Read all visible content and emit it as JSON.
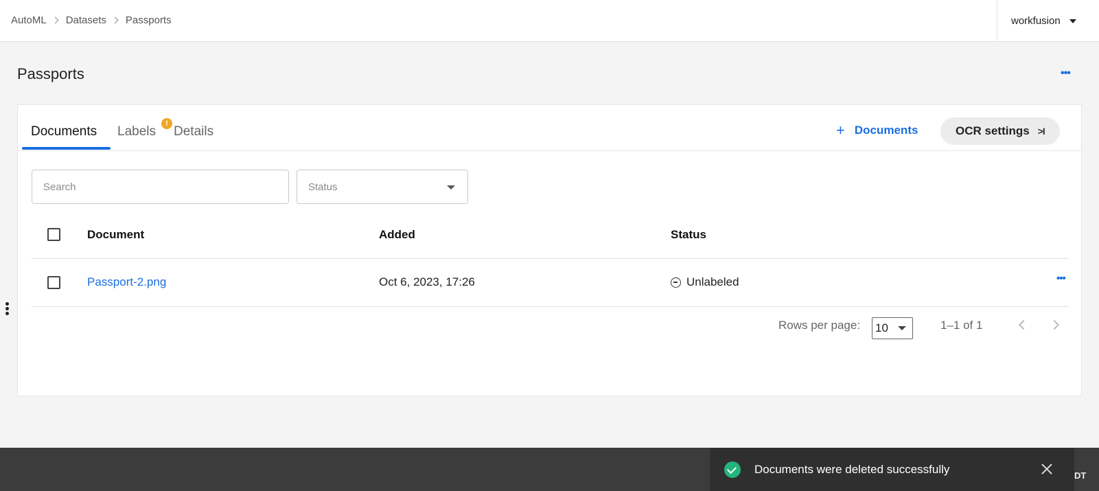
{
  "header": {
    "breadcrumb": [
      "AutoML",
      "Datasets",
      "Passports"
    ],
    "user_menu_label": "workfusion"
  },
  "page": {
    "title": "Passports",
    "more_icon": "ellipsis-icon"
  },
  "tabs": [
    {
      "label": "Documents",
      "active": true
    },
    {
      "label": "Labels",
      "active": false,
      "badge": "!"
    },
    {
      "label": "Details",
      "active": false
    }
  ],
  "actions": {
    "add_documents_label": "Documents",
    "add_icon": "plus-icon",
    "ocr_settings_label": "OCR settings",
    "ocr_icon": "collapse-right-icon"
  },
  "filters": {
    "search_placeholder": "Search",
    "status_placeholder": "Status"
  },
  "table": {
    "columns": [
      "Document",
      "Added",
      "Status"
    ],
    "rows": [
      {
        "document": "Passport-2.png",
        "added": "Oct 6, 2023, 17:26",
        "status": "Unlabeled",
        "status_icon": "minus-circle-icon"
      }
    ]
  },
  "pagination": {
    "rows_per_page_label": "Rows per page:",
    "rows_per_page_value": "10",
    "range_label": "1–1 of 1"
  },
  "toast": {
    "message": "Documents were deleted successfully",
    "icon": "check-circle-icon",
    "color": "#24b47e"
  },
  "bottom_bar": {
    "edge_text": "DT"
  },
  "colors": {
    "accent": "#1a6ee0",
    "badge": "#f0a623"
  }
}
